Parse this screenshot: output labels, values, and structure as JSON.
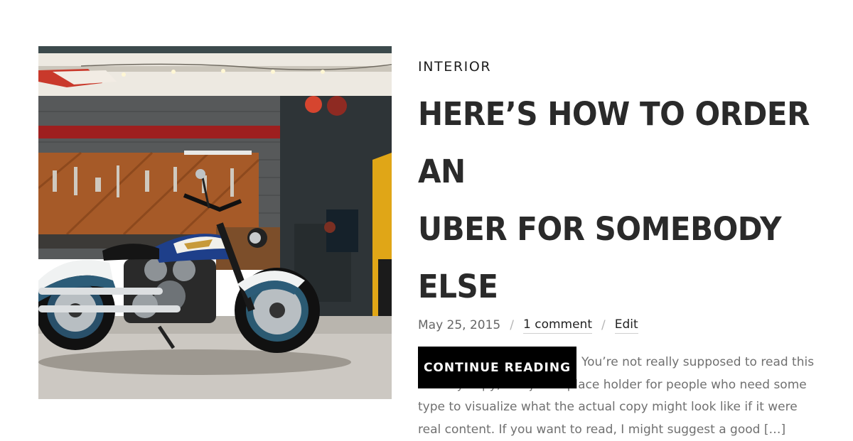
{
  "post": {
    "image_alt": "Motorcycle parked in a garage workshop",
    "category": "INTERIOR",
    "title_line1": "HERE’S HOW TO ORDER AN",
    "title_line2": "UBER FOR SOMEBODY ELSE",
    "meta": {
      "date": "May 25, 2015",
      "separator": "/",
      "comments": "1 comment",
      "edit": "Edit"
    },
    "excerpt": "This is some dummy copy. You’re not really supposed to read this dummy copy, it is just a place holder for people who need some type to visualize what the actual copy might look like if it were real content. If you want to read, I might suggest a good […]",
    "button_label": "CONTINUE READING"
  },
  "colors": {
    "button_bg": "#000000",
    "title": "#2a2a2a",
    "excerpt": "#707070"
  }
}
